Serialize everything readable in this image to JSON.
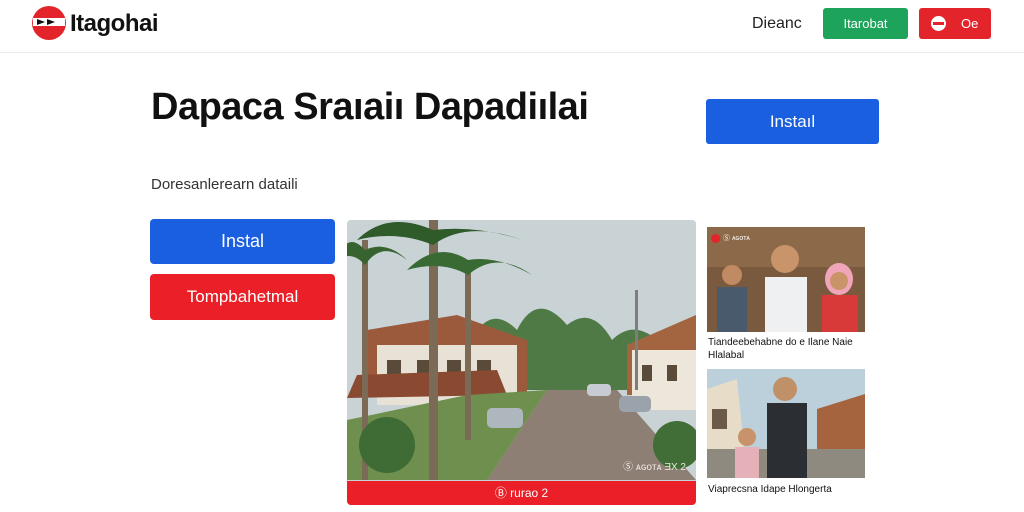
{
  "header": {
    "brand": "Itagohai",
    "logo_icon": "brand-logo-icon",
    "nav_link": "Dieanc",
    "green_button": "Itarobat",
    "red_button": "Oe",
    "red_button_icon": "circle-icon"
  },
  "hero": {
    "title": "Dapaca Sraıaiı Dapadiılai",
    "subtitle": "Doresanlerearn dataili",
    "install_top": "Instaıl",
    "install_left": "Instal",
    "red_left": "Tompbahetmal"
  },
  "main_photo": {
    "caption": "Ⓑ rurao 2",
    "watermark": "Ⓢ ᴀɢᴏᴛᴀ ƎX 2"
  },
  "side_cards": [
    {
      "tag": "Ⓢ ᴀɢᴏᴛᴀ",
      "caption": "Tiandeebehabne do e Ilane Naie Hlalabal"
    },
    {
      "caption": "Viaprecsna Idape Hlongerta"
    }
  ],
  "colors": {
    "accent_blue": "#1a5fe0",
    "accent_red": "#ea1f27",
    "accent_green": "#1ea35a"
  }
}
